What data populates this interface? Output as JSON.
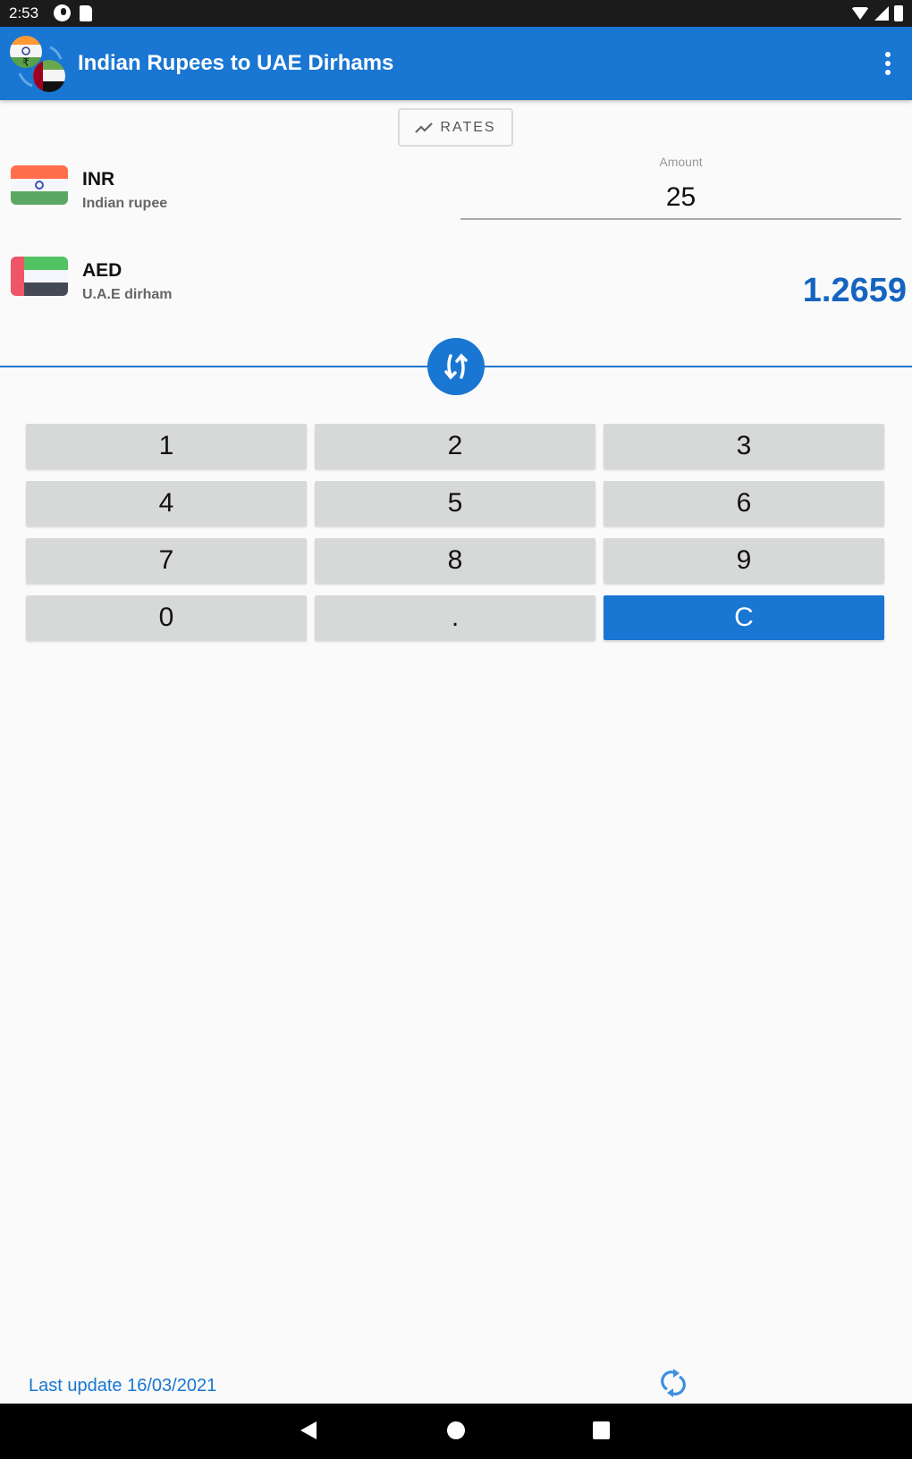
{
  "status_bar": {
    "time": "2:53",
    "left_icons": [
      "app-notification-icon",
      "sd-card-icon"
    ],
    "right_icons": [
      "wifi-icon",
      "cell-signal-icon",
      "battery-icon"
    ]
  },
  "app_bar": {
    "title": "Indian Rupees to UAE Dirhams",
    "logo_icon": "currency-exchange-logo",
    "menu_icon": "more-vert-icon"
  },
  "rates_button": {
    "label": "RATES",
    "icon": "trending-up-icon"
  },
  "from_currency": {
    "code": "INR",
    "name": "Indian rupee",
    "flag": "india-flag"
  },
  "to_currency": {
    "code": "AED",
    "name": "U.A.E dirham",
    "flag": "uae-flag"
  },
  "amount": {
    "label": "Amount",
    "value": "25"
  },
  "result": {
    "value": "1.2659"
  },
  "swap_button": {
    "icon": "swap-vert-icon"
  },
  "keypad": {
    "keys": [
      "1",
      "2",
      "3",
      "4",
      "5",
      "6",
      "7",
      "8",
      "9",
      "0",
      ".",
      "C"
    ]
  },
  "footer": {
    "last_update": "Last update 16/03/2021",
    "refresh_icon": "refresh-icon"
  },
  "nav_bar": {
    "buttons": [
      "back",
      "home",
      "recents"
    ]
  },
  "colors": {
    "primary": "#1976d2",
    "result_text": "#1565c0",
    "key_background": "#d7d8d8",
    "status_bar": "#1b1b1b"
  }
}
